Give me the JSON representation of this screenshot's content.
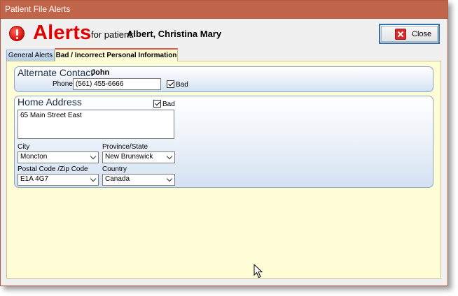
{
  "window": {
    "title": "Patient File Alerts"
  },
  "header": {
    "heading": "Alerts",
    "for_patient_label": "for patient:",
    "patient_name": "Albert, Christina Mary",
    "close_label": "Close"
  },
  "tabs": [
    {
      "label": "General Alerts",
      "active": false
    },
    {
      "label": "Bad / Incorrect Personal Information",
      "active": true
    }
  ],
  "alternate_contact": {
    "title": "Alternate Contact",
    "name": "John",
    "phone_label": "Phone",
    "phone_value": "(561) 455-6666",
    "bad_label": "Bad",
    "bad_checked": true
  },
  "home_address": {
    "title": "Home Address",
    "bad_label": "Bad",
    "bad_checked": true,
    "address_value": "65 Main Street East",
    "city_label": "City",
    "city_value": "Moncton",
    "province_label": "Province/State",
    "province_value": "New Brunswick",
    "postal_label": "Postal Code /Zip Code",
    "postal_value": "E1A 4G7",
    "country_label": "Country",
    "country_value": "Canada"
  },
  "colors": {
    "title_bar": "#c1654a",
    "heading": "#e00000",
    "panel": "#fffdd6",
    "active_tab_accent": "#e05a4a"
  },
  "icons": {
    "alert": "exclamation-circle-icon",
    "close": "red-x-icon",
    "cursor": "mouse-pointer-icon"
  }
}
